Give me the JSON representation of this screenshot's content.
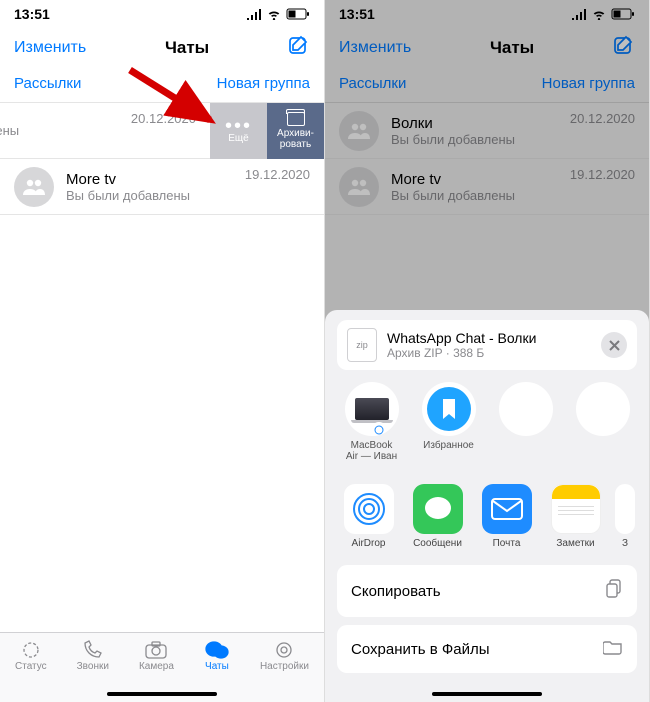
{
  "left": {
    "status": {
      "time": "13:51"
    },
    "nav": {
      "edit": "Изменить",
      "title": "Чаты"
    },
    "subnav": {
      "broadcast": "Рассылки",
      "newgroup": "Новая группа"
    },
    "chat1": {
      "date": "20.12.2020",
      "sub": "добавлены"
    },
    "swipe": {
      "more": "Ещё",
      "archive1": "Архиви-",
      "archive2": "ровать"
    },
    "chat2": {
      "name": "More tv",
      "sub": "Вы были добавлены",
      "date": "19.12.2020"
    },
    "tabs": {
      "status": "Статус",
      "calls": "Звонки",
      "camera": "Камера",
      "chats": "Чаты",
      "settings": "Настройки"
    }
  },
  "right": {
    "status": {
      "time": "13:51"
    },
    "nav": {
      "edit": "Изменить",
      "title": "Чаты"
    },
    "subnav": {
      "broadcast": "Рассылки",
      "newgroup": "Новая группа"
    },
    "chat1": {
      "name": "Волки",
      "sub": "Вы были добавлены",
      "date": "20.12.2020"
    },
    "chat2": {
      "name": "More tv",
      "sub": "Вы были добавлены",
      "date": "19.12.2020"
    },
    "sheet": {
      "ziplabel": "zip",
      "title": "WhatsApp Chat - Волки",
      "subtitle": "Архив ZIP · 388 Б",
      "targets": {
        "mac1": "MacBook",
        "mac2": "Air — Иван",
        "fav": "Избранное"
      },
      "apps": {
        "airdrop": "AirDrop",
        "messages": "Сообщени",
        "mail": "Почта",
        "notes": "Заметки",
        "more": "З"
      },
      "copy": "Скопировать",
      "saveFiles": "Сохранить в Файлы"
    }
  }
}
